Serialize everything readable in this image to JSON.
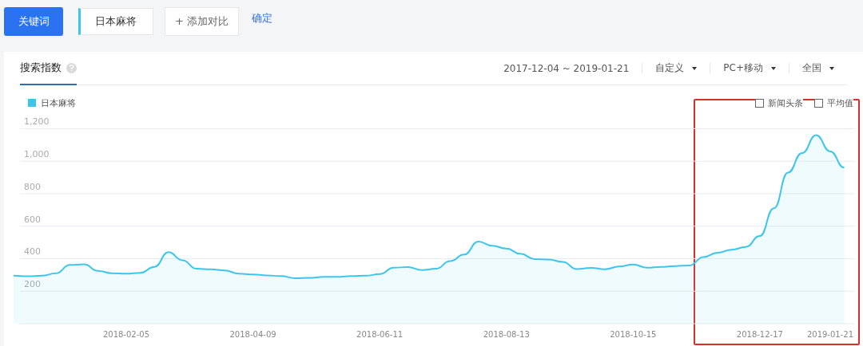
{
  "toolbar": {
    "mode_button": "关键词",
    "keyword": "日本麻将",
    "add_compare": "+ 添加对比",
    "confirm_link": "确定"
  },
  "card": {
    "tabs": [
      {
        "label": "搜索指数",
        "selected": true,
        "help_icon": true
      }
    ],
    "filters": [
      {
        "kind": "text",
        "label": "2017-12-04 ~ 2019-01-21"
      },
      {
        "kind": "dropdown",
        "label": "自定义"
      },
      {
        "kind": "dropdown",
        "label": "PC+移动"
      },
      {
        "kind": "dropdown",
        "label": "全国"
      }
    ],
    "options": [
      {
        "label": "新闻头条",
        "checked": false
      },
      {
        "label": "平均值",
        "checked": false
      }
    ],
    "chart_data": {
      "type": "area",
      "categories": [
        null,
        null,
        null,
        null,
        null,
        null,
        null,
        null,
        null,
        "2018-02-05",
        null,
        null,
        null,
        null,
        null,
        null,
        null,
        null,
        "2018-04-09",
        null,
        null,
        null,
        null,
        null,
        null,
        null,
        null,
        "2018-06-11",
        null,
        null,
        null,
        null,
        null,
        null,
        null,
        null,
        "2018-08-13",
        null,
        null,
        null,
        null,
        null,
        null,
        null,
        null,
        "2018-10-15",
        null,
        null,
        null,
        null,
        null,
        null,
        null,
        null,
        "2018-12-17",
        null,
        null,
        null,
        null,
        "2019-01-21",
        null
      ],
      "series": [
        {
          "name": "日本麻将",
          "color": "#3ec6ea",
          "values": [
            null,
            295,
            292,
            295,
            310,
            362,
            365,
            325,
            310,
            308,
            313,
            350,
            440,
            390,
            338,
            335,
            327,
            308,
            303,
            297,
            293,
            280,
            282,
            288,
            288,
            293,
            295,
            305,
            345,
            348,
            330,
            338,
            385,
            425,
            505,
            480,
            462,
            430,
            398,
            395,
            380,
            336,
            344,
            335,
            352,
            364,
            345,
            350,
            355,
            358,
            410,
            437,
            455,
            472,
            540,
            710,
            930,
            1050,
            1160,
            1060,
            960
          ]
        }
      ],
      "ylim": [
        0,
        1673
      ],
      "grid": true,
      "yticks": [
        {
          "value": 200,
          "label": "200"
        },
        {
          "value": 400,
          "label": "400"
        },
        {
          "value": 600,
          "label": "600"
        },
        {
          "value": 800,
          "label": "800"
        },
        {
          "value": 1000,
          "label": "1,000"
        },
        {
          "value": 1200,
          "label": "1,200"
        }
      ]
    }
  },
  "highlight": {
    "kind": "frame",
    "color": "#d9302c"
  }
}
